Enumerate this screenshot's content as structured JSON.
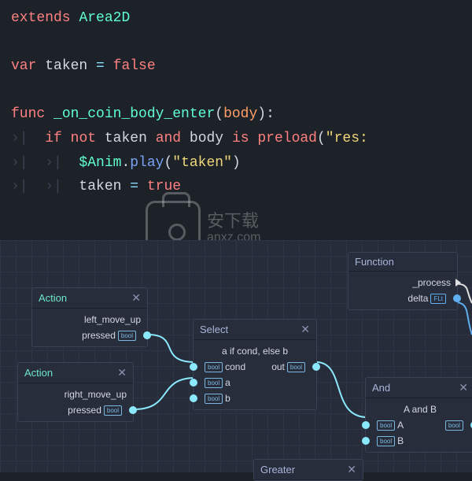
{
  "code": {
    "l1": {
      "extends": "extends",
      "class": "Area2D"
    },
    "l3": {
      "var": "var",
      "name": "taken",
      "eq": " = ",
      "val": "false"
    },
    "l5": {
      "func": "func",
      "name": "_on_coin_body_enter",
      "param": "body"
    },
    "l6": {
      "if": "if",
      "not": "not",
      "taken": "taken",
      "and": "and",
      "body": "body",
      "is": "is",
      "preload": "preload",
      "str": "\"res:"
    },
    "l7": {
      "anim": "$Anim",
      "dot": ".",
      "play": "play",
      "str": "\"taken\""
    },
    "l8": {
      "taken": "taken",
      "eq": " = ",
      "val": "true"
    }
  },
  "nodes": {
    "action1": {
      "title": "Action",
      "label": "left_move_up",
      "out": "pressed",
      "badge": "bool"
    },
    "action2": {
      "title": "Action",
      "label": "right_move_up",
      "out": "pressed",
      "badge": "bool"
    },
    "select": {
      "title": "Select",
      "sub": "a if cond, else b",
      "rows": [
        "cond",
        "a",
        "b"
      ],
      "out": "out",
      "badge": "bool"
    },
    "func": {
      "title": "Function",
      "name": "_process",
      "param": "delta",
      "badge": "FLt"
    },
    "and": {
      "title": "And",
      "sub": "A and B",
      "a": "A",
      "b": "B",
      "badge": "bool"
    },
    "greater": {
      "title": "Greater"
    }
  },
  "watermark": {
    "cn": "安下载",
    "en": "anxz.com"
  }
}
